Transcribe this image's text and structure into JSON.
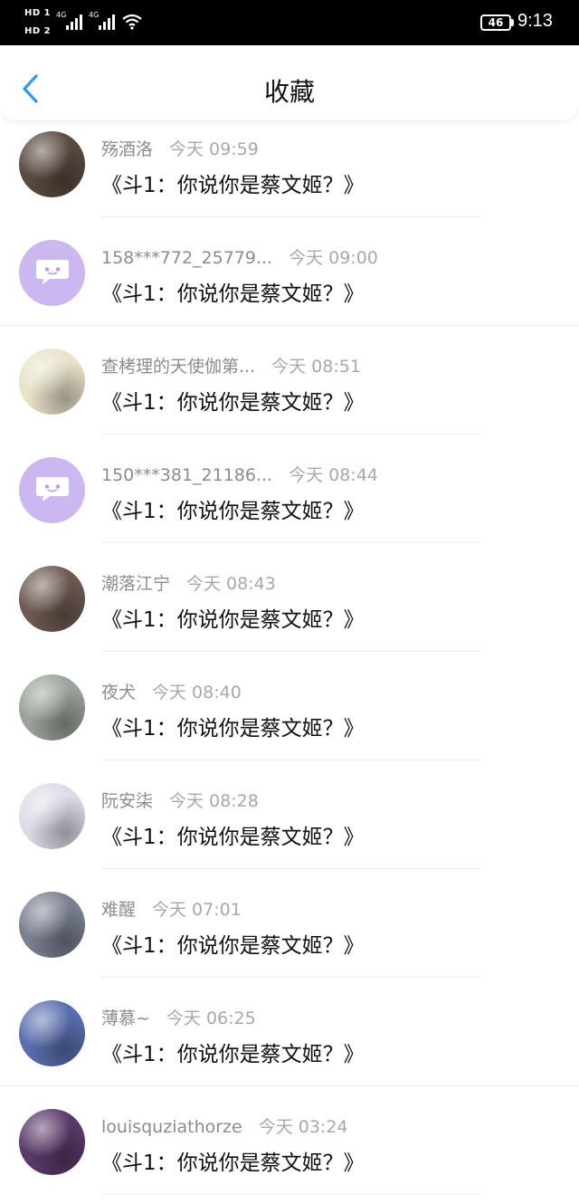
{
  "status_bar": {
    "hd1": "HD 1",
    "hd2": "HD 2",
    "net1": "4G",
    "net2": "4G",
    "battery": "46",
    "time": "9:13"
  },
  "header": {
    "title": "收藏"
  },
  "items": [
    {
      "name": "殇酒洛",
      "time": "今天 09:59",
      "message": "《斗1：你说你是蔡文姬？》",
      "avatar": "photo",
      "color": "#5a4a40"
    },
    {
      "name": "158***772_25779...",
      "time": "今天 09:00",
      "message": "《斗1：你说你是蔡文姬？》",
      "avatar": "default",
      "color": "#cbb8f0"
    },
    {
      "name": "查栲理的天使伽第...",
      "time": "今天 08:51",
      "message": "《斗1：你说你是蔡文姬？》",
      "avatar": "photo",
      "color": "#e8e2c8"
    },
    {
      "name": "150***381_21186...",
      "time": "今天 08:44",
      "message": "《斗1：你说你是蔡文姬？》",
      "avatar": "default",
      "color": "#cbb8f0"
    },
    {
      "name": "潮落江宁",
      "time": "今天 08:43",
      "message": "《斗1：你说你是蔡文姬？》",
      "avatar": "photo",
      "color": "#6e5a52"
    },
    {
      "name": "夜犬",
      "time": "今天 08:40",
      "message": "《斗1：你说你是蔡文姬？》",
      "avatar": "photo",
      "color": "#9aa39a"
    },
    {
      "name": "阮安柒",
      "time": "今天 08:28",
      "message": "《斗1：你说你是蔡文姬？》",
      "avatar": "photo",
      "color": "#dcdce8"
    },
    {
      "name": "难醒",
      "time": "今天 07:01",
      "message": "《斗1：你说你是蔡文姬？》",
      "avatar": "photo",
      "color": "#7a8090"
    },
    {
      "name": "薄慕~",
      "time": "今天 06:25",
      "message": "《斗1：你说你是蔡文姬？》",
      "avatar": "photo",
      "color": "#5a6fb0"
    },
    {
      "name": "louisquziathorze",
      "time": "今天 03:24",
      "message": "《斗1：你说你是蔡文姬？》",
      "avatar": "photo",
      "color": "#5a3a6a"
    }
  ]
}
